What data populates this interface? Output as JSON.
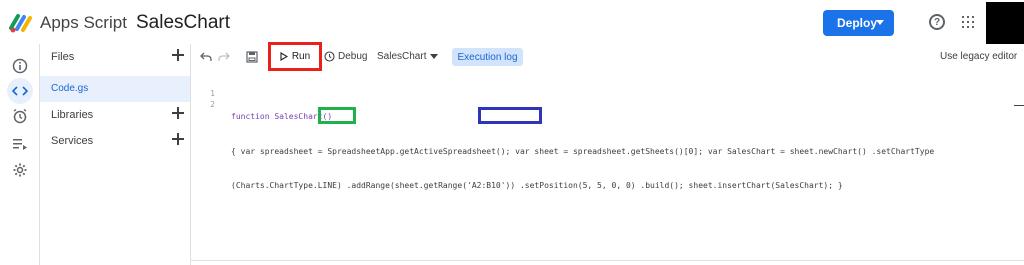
{
  "header": {
    "app_name": "Apps Script",
    "project_name": "SalesChart",
    "deploy_label": "Deploy",
    "help_icon": "help-icon",
    "apps_icon": "apps-grid-icon"
  },
  "rail": {
    "items": [
      "info-icon",
      "code-icon",
      "alarm-clock-icon",
      "executions-icon",
      "gear-icon"
    ]
  },
  "files_panel": {
    "files_label": "Files",
    "file_name": "Code.gs",
    "libraries_label": "Libraries",
    "services_label": "Services"
  },
  "toolbar": {
    "run_label": "Run",
    "debug_label": "Debug",
    "function_name": "SalesChart",
    "execution_log_label": "Execution log",
    "legacy_label": "Use legacy editor"
  },
  "editor": {
    "line_numbers": [
      "1",
      "2"
    ],
    "line1": "function SalesChart()",
    "line2": "{ var spreadsheet = SpreadsheetApp.getActiveSpreadsheet(); var sheet = spreadsheet.getSheets()[0]; var SalesChart = sheet.newChart() .setChartType",
    "line3": "(Charts.ChartType.LINE) .addRange(sheet.getRange('A2:B10')) .setPosition(5, 5, 0, 0) .build(); sheet.insertChart(SalesChart); }"
  },
  "colors": {
    "accent": "#1a73e8",
    "run_highlight": "#e8211c",
    "line_highlight": "#22b04c",
    "range_highlight": "#2e35b8"
  }
}
